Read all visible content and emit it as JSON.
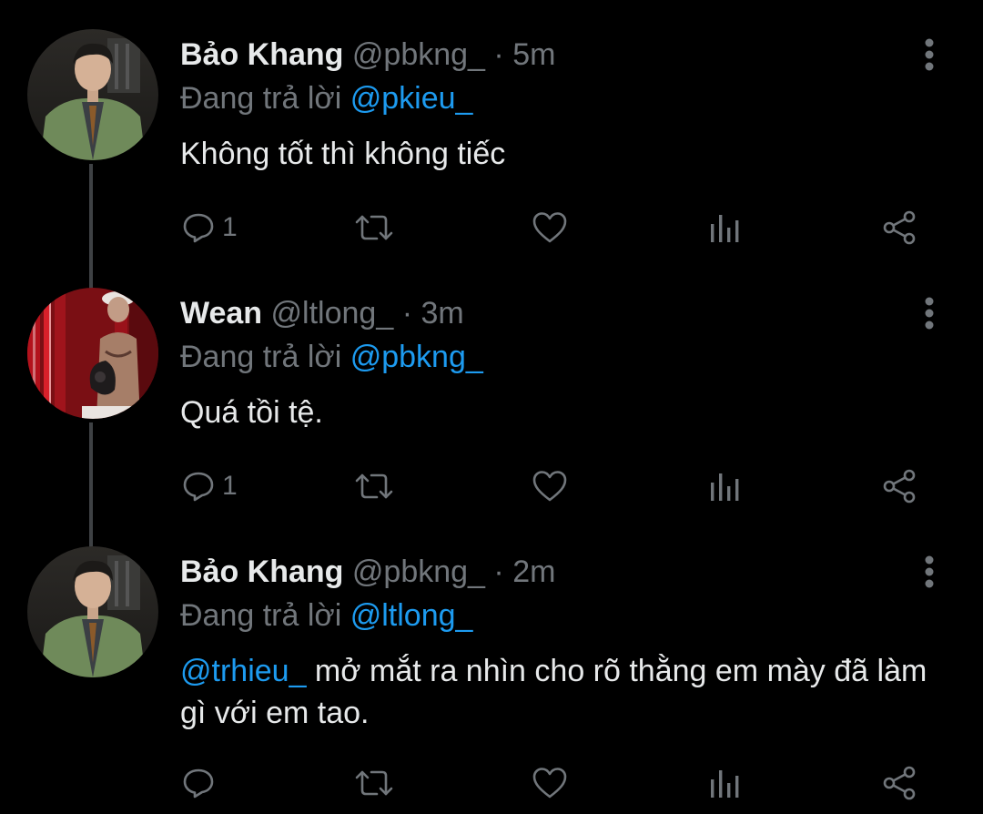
{
  "tweets": [
    {
      "display_name": "Bảo Khang",
      "handle": "@pbkng_",
      "separator": "·",
      "time": "5m",
      "reply_prefix": "Đang trả lời",
      "reply_to": "@pkieu_",
      "text": "Không tốt thì không tiếc",
      "reply_count": "1",
      "avatar_icon": "profile-photo-man-green-jacket"
    },
    {
      "display_name": "Wean",
      "handle": "@ltlong_",
      "separator": "·",
      "time": "3m",
      "reply_prefix": "Đang trả lời",
      "reply_to": "@pbkng_",
      "text": "Quá tồi tệ.",
      "reply_count": "1",
      "avatar_icon": "profile-photo-red-curtain"
    },
    {
      "display_name": "Bảo Khang",
      "handle": "@pbkng_",
      "separator": "·",
      "time": "2m",
      "reply_prefix": "Đang trả lời",
      "reply_to": "@ltlong_",
      "text_mention": "@trhieu_",
      "text": " mở mắt ra nhìn cho rõ thằng em mày đã làm gì với em tao.",
      "reply_count": "",
      "avatar_icon": "profile-photo-man-green-jacket"
    }
  ],
  "actions": [
    "reply-icon",
    "retweet-icon",
    "like-icon",
    "analytics-icon",
    "share-icon"
  ],
  "colors": {
    "background": "#000000",
    "text": "#e7e9ea",
    "secondary": "#71767b",
    "accent": "#1d9bf0",
    "thread_line": "#3e4144"
  }
}
